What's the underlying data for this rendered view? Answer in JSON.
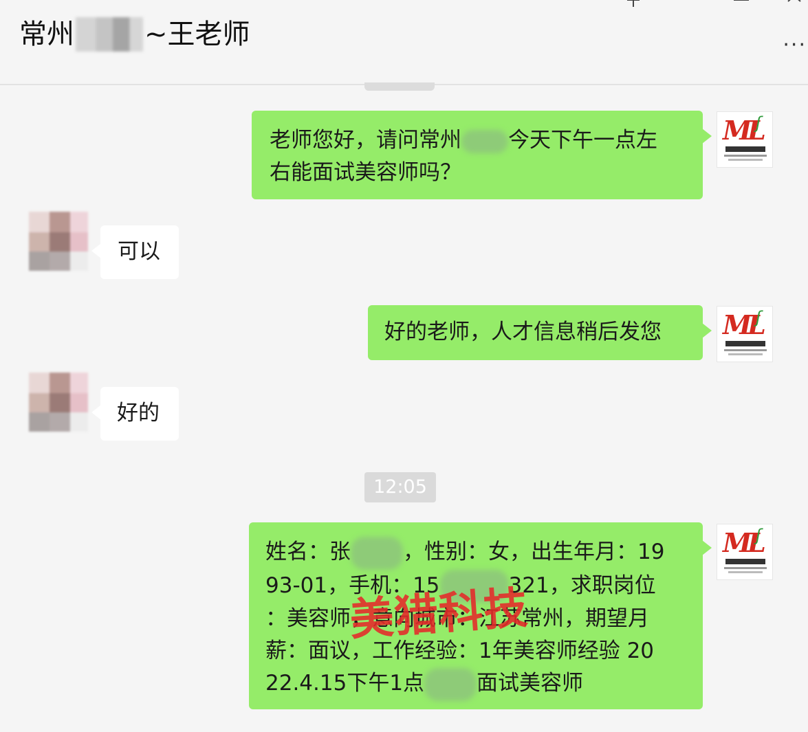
{
  "header": {
    "contact_prefix": "常州",
    "contact_suffix": "~王老师",
    "pin_icon": "pin-icon",
    "min_icon": "minimize-icon",
    "max_icon": "maximize-icon",
    "close_icon": "close-icon",
    "more_icon": "more-icon"
  },
  "messages": [
    {
      "side": "mine",
      "line1_a": "老师您好，请问常州",
      "line1_b": "今天下午一点左",
      "line2": "右能面试美容师吗？"
    },
    {
      "side": "theirs",
      "text": "可以"
    },
    {
      "side": "mine",
      "text": "好的老师，人才信息稍后发您"
    },
    {
      "side": "theirs",
      "text": "好的"
    },
    {
      "side": "mine",
      "line1_a": "姓名：张",
      "line1_b": "，性别：女，出生年月：19",
      "line2_a": "93-01，手机：15",
      "line2_b": "321，求职岗位",
      "line3": "：美容师，意向城市：江苏常州，期望月",
      "line4": "薪：面议，工作经验：1年美容师经验 20",
      "line5_a": "22.4.15下午1点",
      "line5_b": "面试美容师"
    }
  ],
  "timestamp": "12:05",
  "watermark": "美猎科技",
  "logo": {
    "letters": "ML",
    "colors": {
      "red": "#d42a20",
      "green": "#2e9a3a"
    }
  },
  "colors": {
    "my_bubble": "#95ec69",
    "their_bubble": "#ffffff",
    "background": "#f5f5f5"
  }
}
